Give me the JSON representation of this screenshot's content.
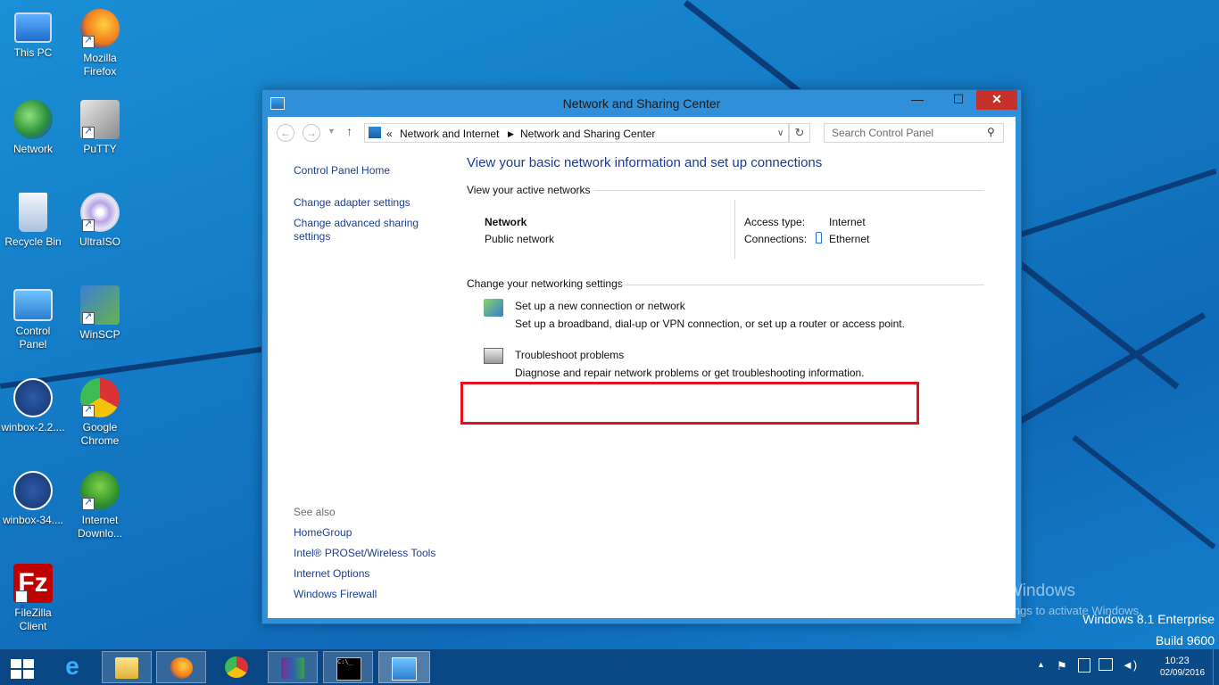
{
  "desktop": {
    "icons": [
      {
        "label": "This PC",
        "icon": "computer-icon"
      },
      {
        "label": "Mozilla Firefox",
        "icon": "firefox-icon"
      },
      {
        "label": "Network",
        "icon": "network-globe-icon"
      },
      {
        "label": "PuTTY",
        "icon": "putty-icon"
      },
      {
        "label": "Recycle Bin",
        "icon": "recycle-bin-icon"
      },
      {
        "label": "UltraISO",
        "icon": "disc-icon"
      },
      {
        "label": "Control Panel",
        "icon": "control-panel-icon"
      },
      {
        "label": "WinSCP",
        "icon": "winscp-icon"
      },
      {
        "label": "winbox-2.2....",
        "icon": "winbox-icon"
      },
      {
        "label": "Google Chrome",
        "icon": "chrome-icon"
      },
      {
        "label": "winbox-34....",
        "icon": "winbox-icon"
      },
      {
        "label": "Internet Downlo...",
        "icon": "download-manager-icon"
      },
      {
        "label": "FileZilla Client",
        "icon": "filezilla-icon"
      }
    ]
  },
  "window": {
    "title": "Network and Sharing Center",
    "address": {
      "prefix": "«",
      "crumb1": "Network and Internet",
      "crumb2": "Network and Sharing Center"
    },
    "search_placeholder": "Search Control Panel",
    "left_nav": {
      "home": "Control Panel Home",
      "adapter": "Change adapter settings",
      "advanced_line1": "Change advanced sharing",
      "advanced_line2": "settings",
      "see_also": "See also",
      "homegroup": "HomeGroup",
      "intel": "Intel® PROSet/Wireless Tools",
      "internet_options": "Internet Options",
      "firewall": "Windows Firewall"
    },
    "main": {
      "heading": "View your basic network information and set up connections",
      "active_networks": "View your active networks",
      "network_name": "Network",
      "network_type": "Public network",
      "access_type_label": "Access type:",
      "access_type_value": "Internet",
      "connections_label": "Connections:",
      "connections_value": "Ethernet",
      "change_settings": "Change your networking settings",
      "setup_link": "Set up a new connection or network",
      "setup_desc": "Set up a broadband, dial-up or VPN connection, or set up a router or access point.",
      "troubleshoot_link": "Troubleshoot problems",
      "troubleshoot_desc": "Diagnose and repair network problems or get troubleshooting information."
    }
  },
  "watermark": {
    "line1": "Activate Windows",
    "line2": "Go to PC settings to activate Windows.",
    "edition": "Windows 8.1 Enterprise",
    "build": "Build 9600"
  },
  "taskbar": {
    "time": "10:23",
    "date": "02/09/2016"
  },
  "colors": {
    "accent": "#2f8fd8",
    "highlight": "#e3101e",
    "link": "#1e5cc7"
  }
}
